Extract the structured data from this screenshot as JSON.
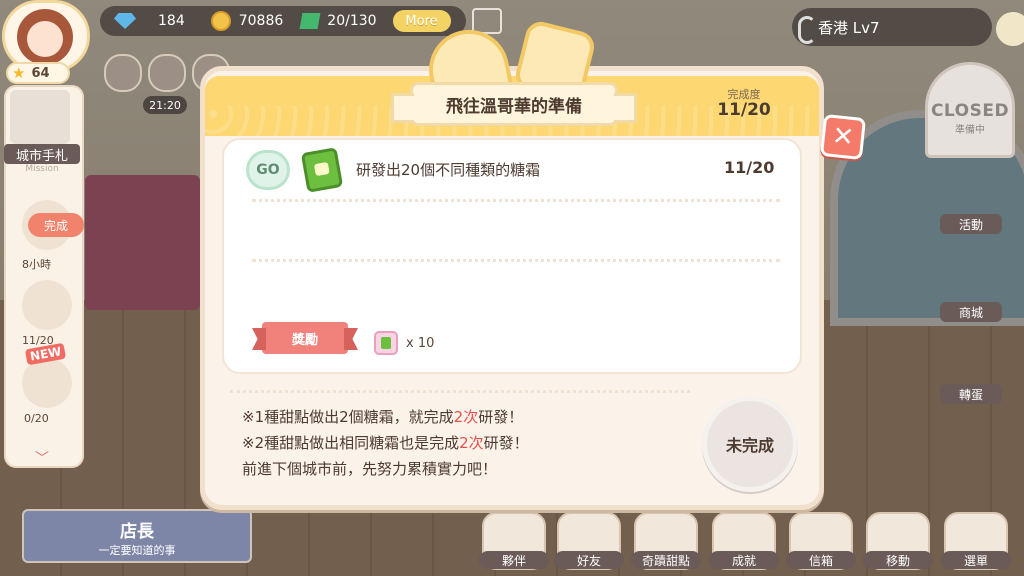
{
  "hud": {
    "player_level": "64",
    "gems": "184",
    "coins": "70886",
    "tickets": "20/130",
    "more_label": "More",
    "city_level": "香港 Lv7",
    "timer": "21:20"
  },
  "mission_sidebar": {
    "title": "城市手札",
    "subtitle": "Mission",
    "items": [
      {
        "tag": "完成",
        "text": "8小時"
      },
      {
        "text": "11/20"
      },
      {
        "badge": "NEW",
        "text": "0/20"
      }
    ]
  },
  "right_menu": {
    "closed_sign_title": "CLOSED",
    "closed_sign_sub": "準備中",
    "items": [
      "活動",
      "商城",
      "轉蛋"
    ]
  },
  "bottom_menu": {
    "banner_title": "店長",
    "banner_sub": "一定要知道的事",
    "items": [
      "夥伴",
      "好友",
      "奇蹟甜點",
      "成就",
      "信箱",
      "移動",
      "選單"
    ]
  },
  "modal": {
    "title": "飛往溫哥華的準備",
    "progress_label": "完成度",
    "progress_value": "11/20",
    "task": {
      "go_label": "GO",
      "text": "研發出20個不同種類的糖霜",
      "count": "11/20"
    },
    "reward": {
      "label": "獎勵",
      "quantity": "x 10"
    },
    "notes": [
      {
        "pre": "※1種甜點做出2個糖霜，就完成",
        "hl": "2次",
        "post": "研發！"
      },
      {
        "pre": "※2種甜點做出相同糖霜也是完成",
        "hl": "2次",
        "post": "研發！"
      },
      {
        "pre": "前進下個城市前，先努力累積實力吧！",
        "hl": "",
        "post": ""
      }
    ],
    "status_label": "未完成",
    "close_symbol": "✕"
  }
}
